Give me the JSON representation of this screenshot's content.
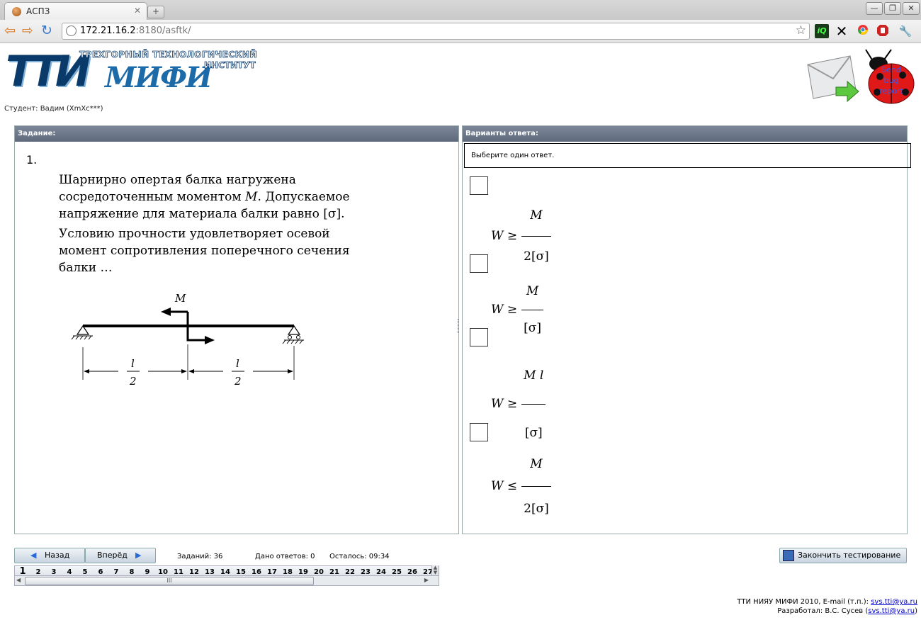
{
  "browser": {
    "tab_title": "АСПЗ",
    "tab_close": "✕",
    "new_tab": "+",
    "win_min": "—",
    "win_restore": "❐",
    "win_close": "✕",
    "url_host": "172.21.16.2",
    "url_rest": ":8180/asftk/",
    "back_icon": "⇦",
    "forward_icon": "⇨",
    "reload_icon": "↻",
    "star_icon": "☆",
    "ext_iq": "iQ",
    "ext_x": "✕",
    "ext_stop": "✋",
    "ext_wrench": "🔧"
  },
  "header": {
    "logo_abbr": "ТТИ",
    "logo_mifi": "МИФИ",
    "logo_line1": "ТРЕХГОРНЫЙ ТЕХНОЛОГИЧЕСКИЙ",
    "logo_line2": "ИНСТИТУТ",
    "student": "Студент: Вадим (XmXc***)",
    "bug_label": "Send bug report"
  },
  "task": {
    "panel_title": "Задание:",
    "number": "1.",
    "para1": "Шарнирно опертая балка нагружена сосредоточенным моментом",
    "var_M": "M",
    "para1b": ". Допускаемое напряжение для материала балки равно",
    "sigma": "[σ]",
    "para2": "Условию прочности удовлетворяет осевой момент сопротивления поперечного сечения балки …",
    "fig_M": "M",
    "fig_l": "l",
    "fig_2": "2"
  },
  "answers": {
    "panel_title": "Варианты ответа:",
    "hint": "Выберите один ответ.",
    "options": [
      {
        "lhs": "W ≥",
        "num": "M",
        "den": "2[σ]"
      },
      {
        "lhs": "W ≥",
        "num": "M",
        "den": "[σ]"
      },
      {
        "lhs": "W ≥",
        "num": "M l",
        "den": "[σ]"
      },
      {
        "lhs": "W ≤",
        "num": "M",
        "den": "2[σ]"
      }
    ]
  },
  "nav": {
    "back_label": "Назад",
    "forward_label": "Вперёд",
    "tasks": "Заданий: 36",
    "answered": "Дано ответов: 0",
    "remaining": "Осталось: 09:34",
    "finish_label": "Закончить тестирование",
    "pages": [
      "1",
      "2",
      "3",
      "4",
      "5",
      "6",
      "7",
      "8",
      "9",
      "10",
      "11",
      "12",
      "13",
      "14",
      "15",
      "16",
      "17",
      "18",
      "19",
      "20",
      "21",
      "22",
      "23",
      "24",
      "25",
      "26",
      "27"
    ],
    "thumb_grip": "III"
  },
  "footer": {
    "line1_text": "ТТИ НИЯУ МИФИ 2010, E-mail (т.п.): ",
    "line1_link": "svs.tti@ya.ru",
    "line2_text": "Разработал: В.С. Сусев (",
    "line2_link": "svs.tti@ya.ru",
    "line2_end": ")"
  }
}
